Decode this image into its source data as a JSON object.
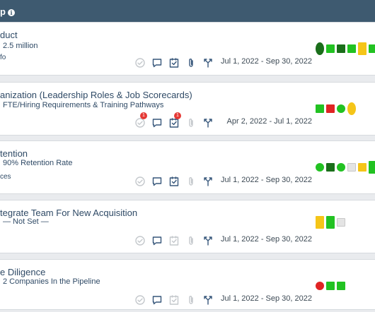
{
  "header": {
    "title": "p",
    "info_icon": "info-icon"
  },
  "colors": {
    "header_bg": "#3e5a70",
    "green": "#22c222",
    "dark_green": "#1a6e1a",
    "yellow": "#f5c518",
    "red": "#e02424",
    "light_gray": "#e4e4e4",
    "icon_blue": "#36567a",
    "icon_gray": "#c4c8cc"
  },
  "rows": [
    {
      "title": "duct",
      "subtitle": "2.5 million",
      "extra": "fo",
      "date_range": "Jul 1, 2022 - Sep 30, 2022",
      "icons": [
        "check-circle-icon",
        "comment-icon",
        "checklist-icon",
        "paperclip-icon",
        "merge-icon"
      ],
      "icon_active": [
        false,
        true,
        true,
        true,
        true
      ],
      "badges": [
        "",
        "",
        "",
        "",
        ""
      ],
      "kpis": [
        "dark-green-ellipse",
        "green-square",
        "dark-green-square",
        "green-square",
        "yellow-rect",
        "green-square"
      ]
    },
    {
      "title": "anization (Leadership Roles & Job Scorecards)",
      "subtitle": "FTE/Hiring Requirements & Training Pathways",
      "extra": "",
      "date_range": "Apr 2, 2022 - Jul 1, 2022",
      "icons": [
        "check-circle-icon",
        "comment-icon",
        "checklist-icon",
        "paperclip-icon",
        "merge-icon"
      ],
      "icon_active": [
        false,
        true,
        true,
        false,
        true
      ],
      "badges": [
        "1",
        "",
        "1",
        "",
        ""
      ],
      "kpis": [
        "green-square",
        "red-square",
        "green-circle",
        "yellow-ellipse"
      ]
    },
    {
      "title": "tention",
      "subtitle": "90% Retention Rate",
      "extra": "ces",
      "date_range": "Jul 1, 2022 - Sep 30, 2022",
      "icons": [
        "check-circle-icon",
        "comment-icon",
        "checklist-icon",
        "paperclip-icon",
        "merge-icon"
      ],
      "icon_active": [
        false,
        true,
        true,
        false,
        true
      ],
      "badges": [
        "",
        "",
        "",
        "",
        ""
      ],
      "kpis": [
        "green-circle",
        "dark-green-square",
        "green-circle",
        "gray-square",
        "yellow-square",
        "green-rect"
      ]
    },
    {
      "title": "tegrate Team For New Acquisition",
      "subtitle": "— Not Set —",
      "extra": "",
      "date_range": "Jul 1, 2022 - Sep 30, 2022",
      "icons": [
        "check-circle-icon",
        "comment-icon",
        "checklist-icon",
        "paperclip-icon",
        "merge-icon"
      ],
      "icon_active": [
        false,
        true,
        false,
        false,
        true
      ],
      "badges": [
        "",
        "",
        "",
        "",
        ""
      ],
      "kpis": [
        "yellow-rect",
        "green-rect",
        "gray-square"
      ]
    },
    {
      "title": "e Diligence",
      "subtitle": "2 Companies In the Pipeline",
      "extra": "",
      "date_range": "Jul 1, 2022 - Sep 30, 2022",
      "icons": [
        "check-circle-icon",
        "comment-icon",
        "checklist-icon",
        "paperclip-icon",
        "merge-icon"
      ],
      "icon_active": [
        false,
        true,
        false,
        false,
        true
      ],
      "badges": [
        "",
        "",
        "",
        "",
        ""
      ],
      "kpis": [
        "red-circle",
        "green-square",
        "green-square"
      ]
    }
  ]
}
